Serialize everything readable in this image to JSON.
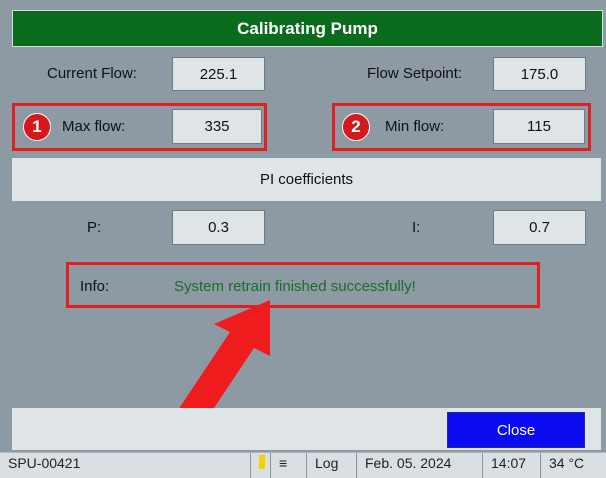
{
  "dialog": {
    "title": "Calibrating Pump",
    "current_flow": {
      "label": "Current Flow:",
      "value": "225.1"
    },
    "flow_setpoint": {
      "label": "Flow Setpoint:",
      "value": "175.0"
    },
    "max_flow": {
      "badge": "1",
      "label": "Max flow:",
      "value": "335"
    },
    "min_flow": {
      "badge": "2",
      "label": "Min flow:",
      "value": "115"
    },
    "pi_section": "PI coefficients",
    "p": {
      "label": "P:",
      "value": "0.3"
    },
    "i": {
      "label": "I:",
      "value": "0.7"
    },
    "info": {
      "label": "Info:",
      "message": "System retrain finished successfully!"
    },
    "close_label": "Close"
  },
  "taskbar": {
    "id_text": "SPU-00421",
    "log_label": "Log",
    "date": "Feb. 05. 2024",
    "time": "14:07",
    "temperature": "34 °C"
  },
  "colors": {
    "title_bg": "#0b6b1c",
    "highlight": "#e0201f",
    "close_bg": "#0a0af0",
    "info_text": "#1d6a2a"
  }
}
